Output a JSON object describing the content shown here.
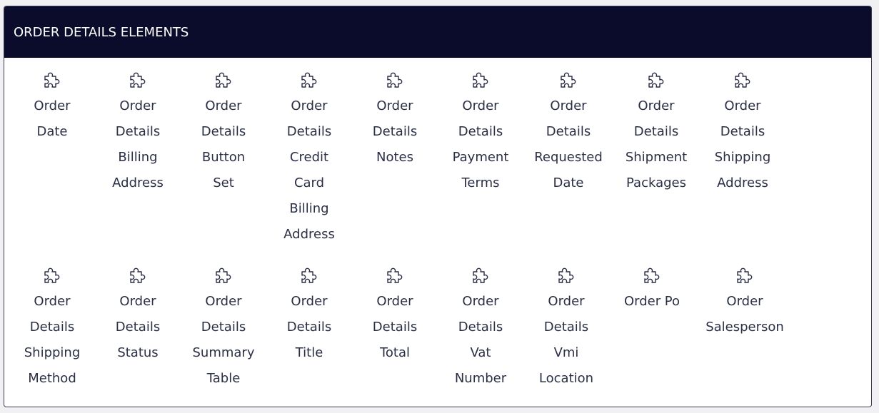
{
  "panel": {
    "title": "ORDER DETAILS ELEMENTS"
  },
  "icon_name": "puzzle-piece-icon",
  "rows": [
    [
      {
        "label": "Order\nDate"
      },
      {
        "label": "Order\nDetails\nBilling\nAddress"
      },
      {
        "label": "Order\nDetails\nButton\nSet"
      },
      {
        "label": "Order\nDetails\nCredit\nCard\nBilling\nAddress"
      },
      {
        "label": "Order\nDetails\nNotes"
      },
      {
        "label": "Order\nDetails\nPayment\nTerms"
      },
      {
        "label": "Order\nDetails\nRequested\nDate"
      },
      {
        "label": "Order\nDetails\nShipment\nPackages"
      },
      {
        "label": "Order\nDetails\nShipping\nAddress"
      }
    ],
    [
      {
        "label": "Order\nDetails\nShipping\nMethod"
      },
      {
        "label": "Order\nDetails\nStatus"
      },
      {
        "label": "Order\nDetails\nSummary\nTable"
      },
      {
        "label": "Order\nDetails\nTitle"
      },
      {
        "label": "Order\nDetails\nTotal"
      },
      {
        "label": "Order\nDetails\nVat\nNumber"
      },
      {
        "label": "Order\nDetails\nVmi\nLocation"
      },
      {
        "label": "Order Po"
      },
      {
        "label": "Order\nSalesperson"
      }
    ]
  ]
}
